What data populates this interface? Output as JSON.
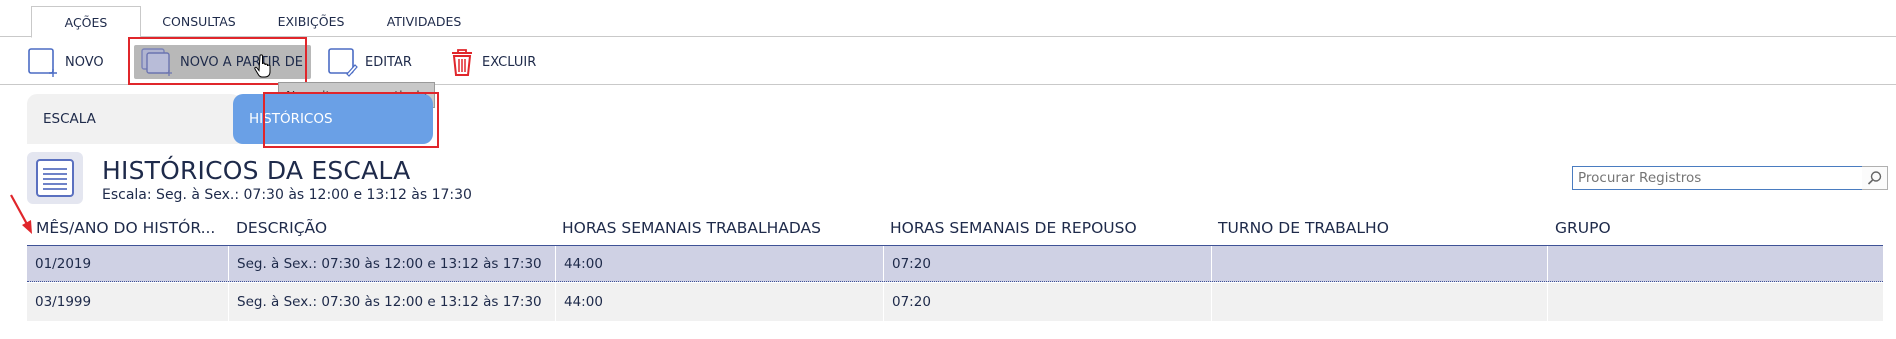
{
  "menu": {
    "tabs": [
      {
        "label": "AÇÕES"
      },
      {
        "label": "CONSULTAS"
      },
      {
        "label": "EXIBIÇÕES"
      },
      {
        "label": "ATIVIDADES"
      }
    ]
  },
  "toolbar": {
    "novo": "NOVO",
    "novo_a_partir": "NOVO A PARTIR DE",
    "editar": "EDITAR",
    "excluir": "EXCLUIR",
    "tooltip": "Novo item a apartir de"
  },
  "subtabs": {
    "escala": "ESCALA",
    "historicos": "HISTÓRICOS"
  },
  "header": {
    "title": "HISTÓRICOS DA ESCALA",
    "subtitle": "Escala: Seg. à Sex.: 07:30 às 12:00 e 13:12 às 17:30"
  },
  "search": {
    "placeholder": "Procurar Registros"
  },
  "table": {
    "columns": [
      "MÊS/ANO DO HISTÓR...",
      "DESCRIÇÃO",
      "HORAS SEMANAIS TRABALHADAS",
      "HORAS SEMANAIS DE REPOUSO",
      "TURNO DE TRABALHO",
      "GRUPO"
    ],
    "rows": [
      {
        "mes_ano": "01/2019",
        "descricao": "Seg. à Sex.: 07:30 às 12:00 e 13:12 às 17:30",
        "horas_trab": "44:00",
        "horas_rep": "07:20",
        "turno": "",
        "grupo": ""
      },
      {
        "mes_ano": "03/1999",
        "descricao": "Seg. à Sex.: 07:30 às 12:00 e 13:12 às 17:30",
        "horas_trab": "44:00",
        "horas_rep": "07:20",
        "turno": "",
        "grupo": ""
      }
    ]
  },
  "colors": {
    "accent": "#6aa0e6",
    "highlight_box": "#e0262b",
    "selected_row": "#cfd1e4",
    "delete_icon": "#e0262b"
  }
}
